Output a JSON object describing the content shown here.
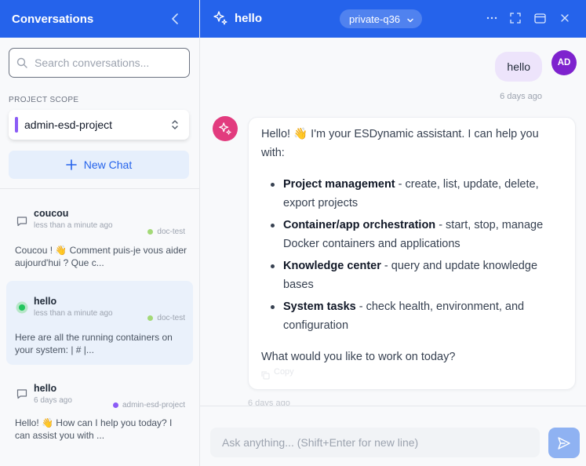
{
  "sidebar": {
    "title": "Conversations",
    "search_placeholder": "Search conversations...",
    "scope_label": "PROJECT SCOPE",
    "scope_value": "admin-esd-project",
    "scope_color": "#8b5cf6",
    "new_chat_label": "New Chat",
    "conversations": [
      {
        "title": "coucou",
        "time": "less than a minute ago",
        "tag": "doc-test",
        "tag_color": "#a3d977",
        "preview": "Coucou ! 👋 Comment puis-je vous aider aujourd'hui ? Que c...",
        "icon": "chat-bubble-icon",
        "active": false
      },
      {
        "title": "hello",
        "time": "less than a minute ago",
        "tag": "doc-test",
        "tag_color": "#a3d977",
        "preview": "Here are all the running containers on your system: | # |...",
        "icon": "active-dot-icon",
        "active": true
      },
      {
        "title": "hello",
        "time": "6 days ago",
        "tag": "admin-esd-project",
        "tag_color": "#8b5cf6",
        "preview": "Hello! 👋 How can I help you today? I can assist you with ...",
        "icon": "chat-bubble-icon",
        "active": false
      }
    ]
  },
  "header": {
    "title": "hello",
    "model": "private-q36",
    "icons": [
      "sparkle-icon",
      "chevron-down-icon",
      "more-icon",
      "expand-icon",
      "window-icon",
      "close-icon"
    ]
  },
  "messages": {
    "user": {
      "text": "hello",
      "avatar": "AD",
      "time": "6 days ago",
      "avatar_color": "#7e22ce"
    },
    "assistant": {
      "avatar_color": "#e23b7e",
      "intro": "Hello! 👋 I'm your ESDynamic assistant. I can help you with:",
      "items": [
        {
          "bold": "Project management",
          "rest": " - create, list, update, delete, export projects"
        },
        {
          "bold": "Container/app orchestration",
          "rest": " - start, stop, manage Docker containers and applications"
        },
        {
          "bold": "Knowledge center",
          "rest": " - query and update knowledge bases"
        },
        {
          "bold": "System tasks",
          "rest": " - check health, environment, and configuration"
        }
      ],
      "outro": "What would you like to work on today?",
      "copy_label": "Copy",
      "time": "6 days ago"
    }
  },
  "composer": {
    "placeholder": "Ask anything... (Shift+Enter for new line)"
  },
  "colors": {
    "accent": "#2563eb",
    "send": "#8fb2f2"
  }
}
